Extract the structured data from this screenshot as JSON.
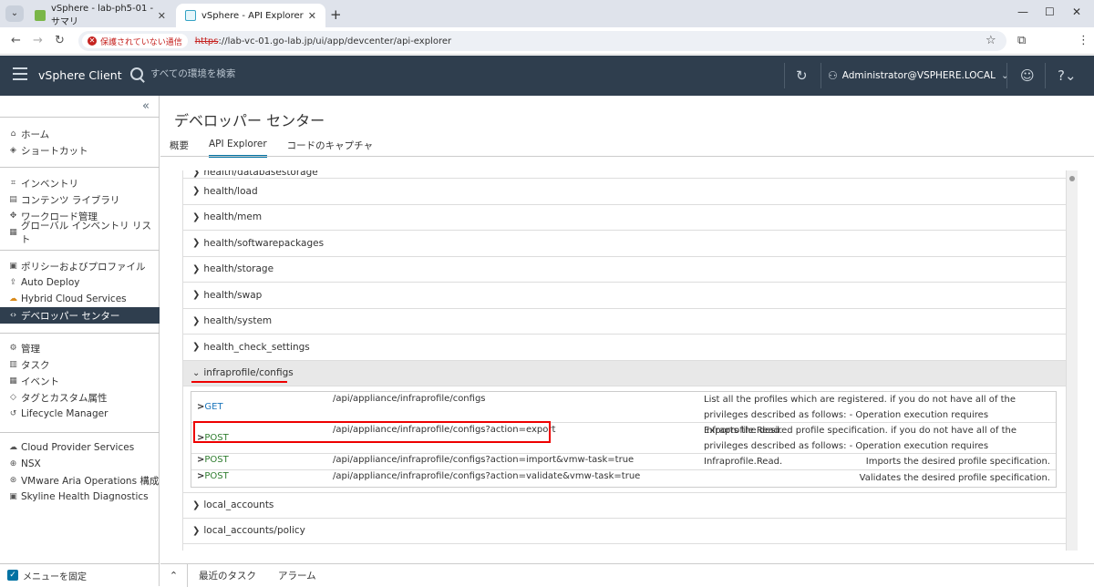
{
  "browser": {
    "tabs": [
      {
        "title": "vSphere - lab-ph5-01 - サマリ"
      },
      {
        "title": "vSphere - API Explorer"
      }
    ],
    "insecure_label": "保護されていない通信",
    "url_scheme": "https",
    "url_rest": "://lab-vc-01.go-lab.jp/ui/app/devcenter/api-explorer"
  },
  "header": {
    "brand": "vSphere Client",
    "search_placeholder": "すべての環境を検索",
    "user": "Administrator@VSPHERE.LOCAL"
  },
  "sidebar": {
    "groups": [
      [
        {
          "label": "ホーム",
          "icon": "home-icon"
        },
        {
          "label": "ショートカット",
          "icon": "shortcut-icon"
        }
      ],
      [
        {
          "label": "インベントリ",
          "icon": "inventory-icon"
        },
        {
          "label": "コンテンツ ライブラリ",
          "icon": "library-icon"
        },
        {
          "label": "ワークロード管理",
          "icon": "workload-icon"
        },
        {
          "label": "グローバル インベントリ リスト",
          "icon": "list-icon"
        }
      ],
      [
        {
          "label": "ポリシーおよびプロファイル",
          "icon": "policy-icon"
        },
        {
          "label": "Auto Deploy",
          "icon": "deploy-icon"
        },
        {
          "label": "Hybrid Cloud Services",
          "icon": "cloud-icon"
        },
        {
          "label": "デベロッパー センター",
          "icon": "code-icon"
        }
      ],
      [
        {
          "label": "管理",
          "icon": "admin-icon"
        },
        {
          "label": "タスク",
          "icon": "task-icon"
        },
        {
          "label": "イベント",
          "icon": "event-icon"
        },
        {
          "label": "タグとカスタム属性",
          "icon": "tag-icon"
        },
        {
          "label": "Lifecycle Manager",
          "icon": "lifecycle-icon"
        }
      ],
      [
        {
          "label": "Cloud Provider Services",
          "icon": "cloud-provider-icon"
        },
        {
          "label": "NSX",
          "icon": "nsx-icon"
        },
        {
          "label": "VMware Aria Operations 構成",
          "icon": "aria-icon"
        },
        {
          "label": "Skyline Health Diagnostics",
          "icon": "skyline-icon"
        }
      ]
    ],
    "pin_label": "メニューを固定"
  },
  "main": {
    "title": "デベロッパー センター",
    "tabs": [
      "概要",
      "API Explorer",
      "コードのキャプチャ"
    ],
    "partial_row": "health/databasestorage",
    "rows_before": [
      "health/load",
      "health/mem",
      "health/softwarepackages",
      "health/storage",
      "health/swap",
      "health/system",
      "health_check_settings"
    ],
    "expanded": "infraprofile/configs",
    "operations": [
      {
        "method": "GET",
        "path": "/api/appliance/infraprofile/configs",
        "desc": "List all the profiles which are registered. if you do not have all of the privileges described as follows: - Operation execution requires Infraprofile.Read."
      },
      {
        "method": "POST",
        "path": "/api/appliance/infraprofile/configs?action=export",
        "desc": "Exports the desired profile specification. if you do not have all of the privileges described as follows: - Operation execution requires Infraprofile.Read."
      },
      {
        "method": "POST",
        "path": "/api/appliance/infraprofile/configs?action=import&vmw-task=true",
        "desc": "Imports the desired profile specification."
      },
      {
        "method": "POST",
        "path": "/api/appliance/infraprofile/configs?action=validate&vmw-task=true",
        "desc": "Validates the desired profile specification."
      }
    ],
    "rows_after": [
      "local_accounts",
      "local_accounts/policy"
    ]
  },
  "bottom": {
    "recent_tasks": "最近のタスク",
    "alarms": "アラーム"
  }
}
